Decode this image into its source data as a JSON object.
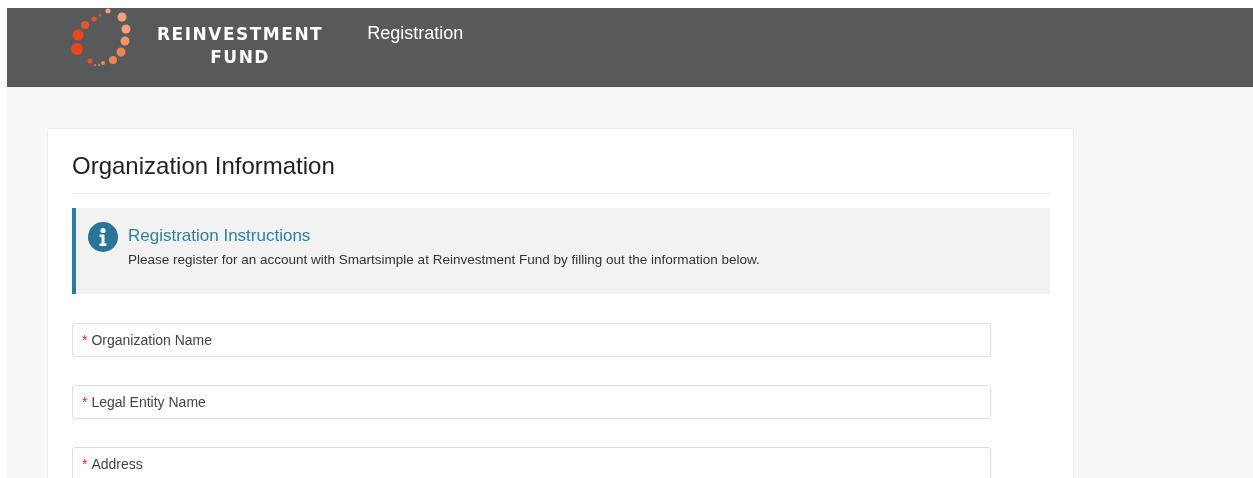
{
  "header": {
    "logo_lines": [
      "REINVESTMENT",
      "FUND"
    ],
    "title": "Registration"
  },
  "card": {
    "title": "Organization Information",
    "notice": {
      "title": "Registration Instructions",
      "text": "Please register for an account with Smartsimple at Reinvestment Fund by filling out the information below."
    },
    "fields": [
      {
        "marker": "*",
        "label": "Organization Name"
      },
      {
        "marker": "*",
        "label": "Legal Entity Name"
      },
      {
        "marker": "*",
        "label": "Address"
      }
    ]
  }
}
